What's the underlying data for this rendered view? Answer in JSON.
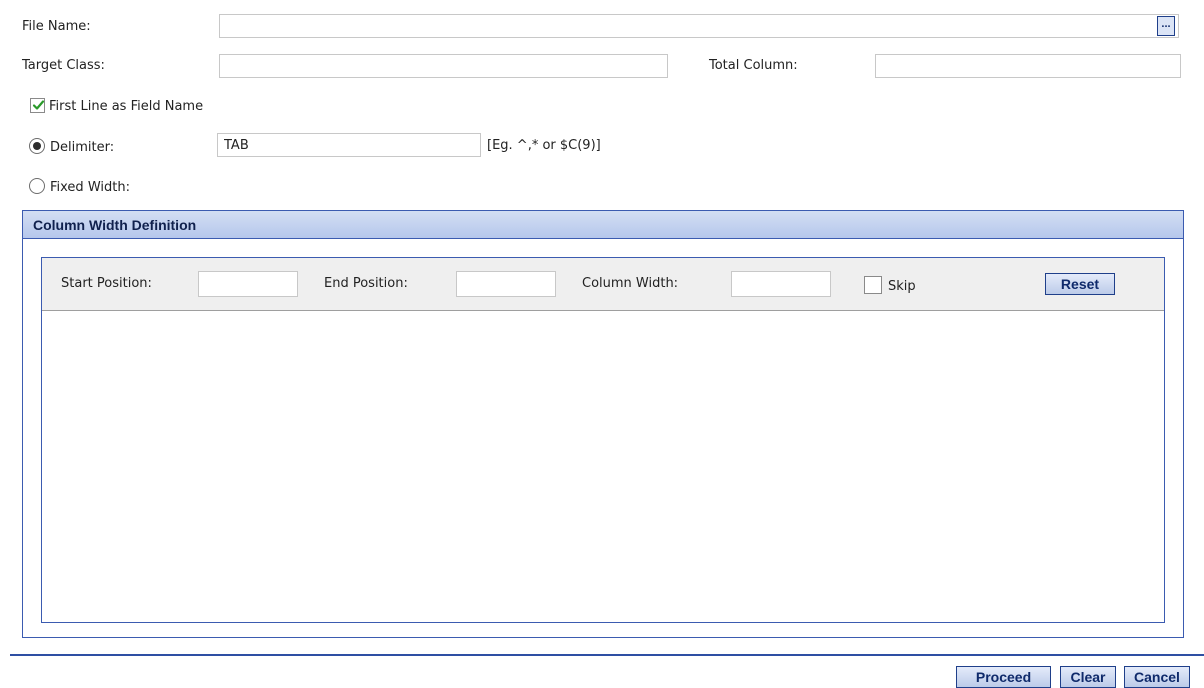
{
  "file_name": {
    "label": "File Name:",
    "value": "",
    "browse_label": "..."
  },
  "target_class": {
    "label": "Target Class:",
    "value": ""
  },
  "total_column": {
    "label": "Total Column:",
    "value": ""
  },
  "first_line": {
    "label": "First Line as Field Name",
    "checked": true
  },
  "delimiter": {
    "label": "Delimiter:",
    "value": "TAB",
    "hint": "[Eg. ^,* or $C(9)]",
    "selected": true
  },
  "fixed_width": {
    "label": "Fixed Width:",
    "selected": false
  },
  "column_width_panel": {
    "title": "Column Width Definition",
    "start_position_label": "Start Position:",
    "end_position_label": "End Position:",
    "column_width_label": "Column Width:",
    "skip_label": "Skip",
    "reset_label": "Reset"
  },
  "footer": {
    "proceed_label": "Proceed",
    "clear_label": "Clear",
    "cancel_label": "Cancel"
  },
  "colors": {
    "accent": "#3b5bb0",
    "button_text": "#0f2a6b",
    "checkmark": "#2a9a2a"
  }
}
